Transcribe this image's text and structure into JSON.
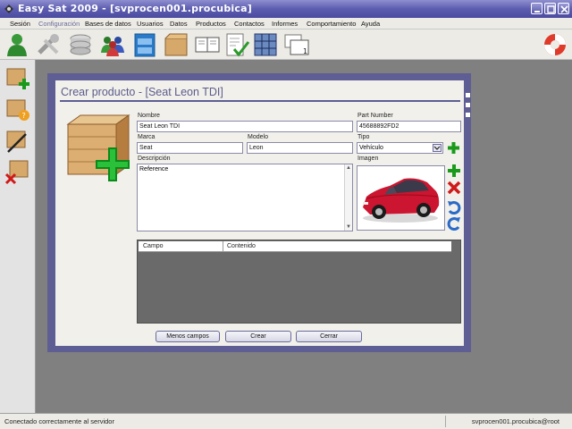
{
  "window": {
    "title": "Easy Sat 2009 - [svprocen001.procubica]"
  },
  "menu": {
    "items": [
      "Sesión",
      "Configuración",
      "Bases de datos",
      "Usuarios",
      "Datos",
      "Productos",
      "Contactos",
      "Informes",
      "Comportamiento",
      "Ayuda"
    ]
  },
  "toolbar": {
    "icons": [
      "user-icon",
      "tools-icon",
      "database-icon",
      "users-group-icon",
      "cabinet-icon",
      "box-icon",
      "book-icon",
      "checklist-icon",
      "network-grid-icon",
      "windows-icon",
      "lifebuoy-icon"
    ]
  },
  "sidebar": {
    "icons": [
      "box-add-icon",
      "box-help-icon",
      "box-edit-icon",
      "box-delete-icon"
    ]
  },
  "form": {
    "title": "Crear producto - [Seat Leon TDI]",
    "nombre_label": "Nombre",
    "nombre_value": "Seat Leon TDI",
    "part_label": "Part Number",
    "part_value": "45688892FD2",
    "marca_label": "Marca",
    "marca_value": "Seat",
    "modelo_label": "Modelo",
    "modelo_value": "Leon",
    "tipo_label": "Tipo",
    "tipo_value": "Vehículo",
    "descripcion_label": "Descripción",
    "descripcion_value": "Reference",
    "imagen_label": "Imagen",
    "car_color": "#cc1530"
  },
  "table": {
    "col1": "Campo",
    "col2": "Contenido"
  },
  "buttons": {
    "menos": "Menos campos",
    "crear": "Crear",
    "cerrar": "Cerrar"
  },
  "status": {
    "left": "Conectado correctamente al servidor",
    "right": "svprocen001.procubica@root"
  },
  "colors": {
    "accent": "#5e5e94",
    "title_bar": "#5d5db0"
  }
}
